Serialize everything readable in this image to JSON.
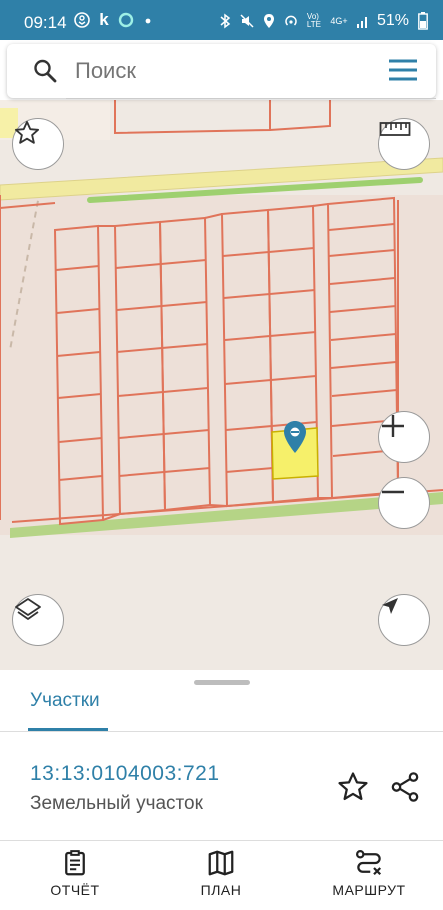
{
  "status_bar": {
    "time": "09:14",
    "battery": "51%",
    "network": "4G+",
    "left_icons": [
      "odnoklassniki-icon",
      "k-app-icon",
      "circle-app-icon",
      "dot-icon"
    ],
    "right_icons": [
      "bluetooth-icon",
      "mute-icon",
      "location-icon",
      "hotspot-icon",
      "volte-icon",
      "signal-icon",
      "battery-icon"
    ]
  },
  "search": {
    "placeholder": "Поиск"
  },
  "map": {
    "controls": [
      "favorite-star-icon",
      "ruler-icon",
      "zoom-in-icon",
      "zoom-out-icon",
      "layers-icon",
      "location-arrow-icon"
    ],
    "marker": "map-pin-icon",
    "colors": {
      "background": "#efe9e3",
      "road_yellow": "#f1eaa0",
      "green_strip": "#9ed06f",
      "parcel_outline": "#e0745a",
      "selected_parcel": "#f6f06a"
    }
  },
  "sheet": {
    "tab_label": "Участки",
    "cadastral_number": "13:13:0104003:721",
    "object_type": "Земельный участок"
  },
  "bottom_nav": {
    "report": "ОТЧЁТ",
    "plan": "ПЛАН",
    "route": "МАРШРУТ"
  },
  "theme": {
    "accent": "#2f80a8",
    "status_bar": "#2f80a8"
  }
}
